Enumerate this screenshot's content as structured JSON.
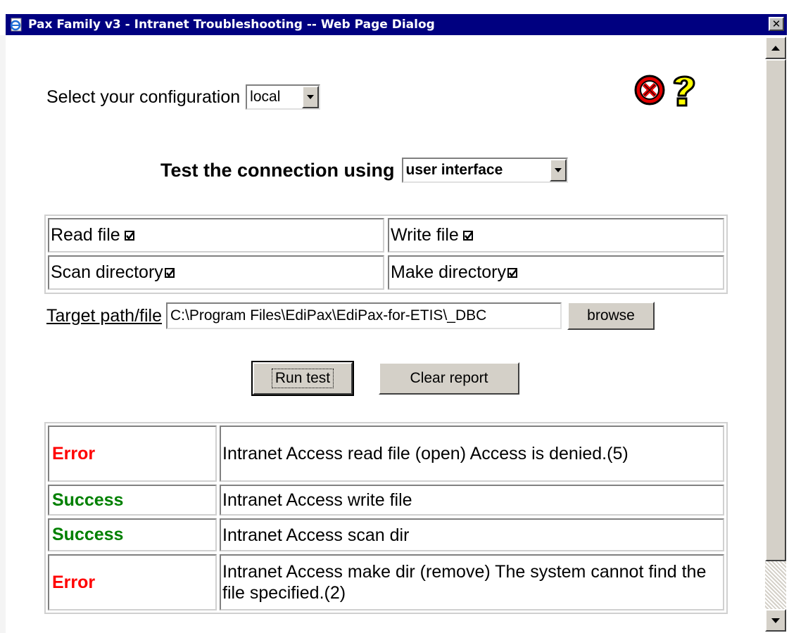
{
  "window": {
    "title": "Pax Family v3 - Intranet Troubleshooting -- Web Page Dialog",
    "close_label": "✕"
  },
  "config": {
    "label": "Select your configuration",
    "selected": "local"
  },
  "connection": {
    "label": "Test the connection using",
    "selected": "user interface"
  },
  "options": [
    {
      "label": "Read file",
      "checked": true
    },
    {
      "label": "Write file",
      "checked": true
    },
    {
      "label": "Scan directory",
      "checked": true
    },
    {
      "label": "Make directory",
      "checked": true
    }
  ],
  "target": {
    "label": "Target path/file",
    "value": "C:\\Program Files\\EdiPax\\EdiPax-for-ETIS\\_DBC",
    "browse_label": "browse"
  },
  "actions": {
    "run_label": "Run test",
    "clear_label": "Clear report"
  },
  "report": [
    {
      "status": "Error",
      "message": "Intranet Access read file (open) Access is denied.(5)"
    },
    {
      "status": "Success",
      "message": "Intranet Access write file"
    },
    {
      "status": "Success",
      "message": "Intranet Access scan dir"
    },
    {
      "status": "Error",
      "message": "Intranet Access make dir (remove) The system cannot find the file specified.(2)"
    }
  ],
  "colors": {
    "titlebar": "#000080",
    "error": "#ff0000",
    "success": "#008000",
    "window_bg": "#ffffff",
    "button_face": "#d4d0c8"
  },
  "icons": {
    "title": "ie-page-icon",
    "close": "close-icon",
    "error": "error-x-icon",
    "help": "question-mark-icon"
  }
}
